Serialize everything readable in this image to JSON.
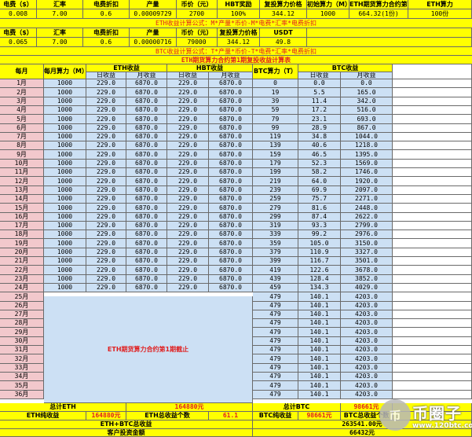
{
  "eth_params": {
    "headers": [
      "电费（$）",
      "汇率",
      "电费折扣",
      "产量",
      "币价（元）",
      "HBT奖励",
      "复投算力价格",
      "初始算力（M）",
      "ETH期货算力合约第1期",
      "ETH算力"
    ],
    "values": [
      "0.008",
      "7.00",
      "0.6",
      "0.00009729",
      "2700",
      "100%",
      "344.12",
      "1000",
      "664.32(1份)",
      "100份"
    ]
  },
  "eth_formula": "ETH收益计算公式：M*产量*币价-M*电费*汇率*电费折扣",
  "btc_params": {
    "headers": [
      "电费（$）",
      "汇率",
      "电费折扣",
      "产量",
      "币价（元）",
      "复投算力价格",
      "USDT"
    ],
    "values": [
      "0.065",
      "7.00",
      "0.6",
      "0.00000716",
      "79000",
      "344.12",
      "49.8"
    ]
  },
  "btc_formula": "BTC收益计算公式：T*产量*币价-T*电费*汇率*电费折扣",
  "table_title": "ETH期货算力合约第1期复投收益计算表",
  "table_headers": {
    "month": "每月",
    "monthly_hash": "每月算力（M）",
    "eth_income": "ETH收益",
    "hbt_income": "HBT收益",
    "btc_hash": "BTC算力（T）",
    "btc_income": "BTC收益",
    "daily": "日收益",
    "monthly": "月收益"
  },
  "rows": [
    {
      "m": "1月",
      "hash": "1000",
      "ed": "229.0",
      "em": "6870.0",
      "hd": "229.0",
      "hm": "6870.0",
      "t": "0",
      "bd": "0.0",
      "bm": "0.0"
    },
    {
      "m": "2月",
      "hash": "1000",
      "ed": "229.0",
      "em": "6870.0",
      "hd": "229.0",
      "hm": "6870.0",
      "t": "19",
      "bd": "5.5",
      "bm": "165.0"
    },
    {
      "m": "3月",
      "hash": "1000",
      "ed": "229.0",
      "em": "6870.0",
      "hd": "229.0",
      "hm": "6870.0",
      "t": "39",
      "bd": "11.4",
      "bm": "342.0"
    },
    {
      "m": "4月",
      "hash": "1000",
      "ed": "229.0",
      "em": "6870.0",
      "hd": "229.0",
      "hm": "6870.0",
      "t": "59",
      "bd": "17.2",
      "bm": "516.0"
    },
    {
      "m": "5月",
      "hash": "1000",
      "ed": "229.0",
      "em": "6870.0",
      "hd": "229.0",
      "hm": "6870.0",
      "t": "79",
      "bd": "23.1",
      "bm": "693.0"
    },
    {
      "m": "6月",
      "hash": "1000",
      "ed": "229.0",
      "em": "6870.0",
      "hd": "229.0",
      "hm": "6870.0",
      "t": "99",
      "bd": "28.9",
      "bm": "867.0"
    },
    {
      "m": "7月",
      "hash": "1000",
      "ed": "229.0",
      "em": "6870.0",
      "hd": "229.0",
      "hm": "6870.0",
      "t": "119",
      "bd": "34.8",
      "bm": "1044.0"
    },
    {
      "m": "8月",
      "hash": "1000",
      "ed": "229.0",
      "em": "6870.0",
      "hd": "229.0",
      "hm": "6870.0",
      "t": "139",
      "bd": "40.6",
      "bm": "1218.0"
    },
    {
      "m": "9月",
      "hash": "1000",
      "ed": "229.0",
      "em": "6870.0",
      "hd": "229.0",
      "hm": "6870.0",
      "t": "159",
      "bd": "46.5",
      "bm": "1395.0"
    },
    {
      "m": "10月",
      "hash": "1000",
      "ed": "229.0",
      "em": "6870.0",
      "hd": "229.0",
      "hm": "6870.0",
      "t": "179",
      "bd": "52.3",
      "bm": "1569.0"
    },
    {
      "m": "11月",
      "hash": "1000",
      "ed": "229.0",
      "em": "6870.0",
      "hd": "229.0",
      "hm": "6870.0",
      "t": "199",
      "bd": "58.2",
      "bm": "1746.0"
    },
    {
      "m": "12月",
      "hash": "1000",
      "ed": "229.0",
      "em": "6870.0",
      "hd": "229.0",
      "hm": "6870.0",
      "t": "219",
      "bd": "64.0",
      "bm": "1920.0"
    },
    {
      "m": "13月",
      "hash": "1000",
      "ed": "229.0",
      "em": "6870.0",
      "hd": "229.0",
      "hm": "6870.0",
      "t": "239",
      "bd": "69.9",
      "bm": "2097.0"
    },
    {
      "m": "14月",
      "hash": "1000",
      "ed": "229.0",
      "em": "6870.0",
      "hd": "229.0",
      "hm": "6870.0",
      "t": "259",
      "bd": "75.7",
      "bm": "2271.0"
    },
    {
      "m": "15月",
      "hash": "1000",
      "ed": "229.0",
      "em": "6870.0",
      "hd": "229.0",
      "hm": "6870.0",
      "t": "279",
      "bd": "81.6",
      "bm": "2448.0"
    },
    {
      "m": "16月",
      "hash": "1000",
      "ed": "229.0",
      "em": "6870.0",
      "hd": "229.0",
      "hm": "6870.0",
      "t": "299",
      "bd": "87.4",
      "bm": "2622.0"
    },
    {
      "m": "17月",
      "hash": "1000",
      "ed": "229.0",
      "em": "6870.0",
      "hd": "229.0",
      "hm": "6870.0",
      "t": "319",
      "bd": "93.3",
      "bm": "2799.0"
    },
    {
      "m": "18月",
      "hash": "1000",
      "ed": "229.0",
      "em": "6870.0",
      "hd": "229.0",
      "hm": "6870.0",
      "t": "339",
      "bd": "99.2",
      "bm": "2976.0"
    },
    {
      "m": "19月",
      "hash": "1000",
      "ed": "229.0",
      "em": "6870.0",
      "hd": "229.0",
      "hm": "6870.0",
      "t": "359",
      "bd": "105.0",
      "bm": "3150.0"
    },
    {
      "m": "20月",
      "hash": "1000",
      "ed": "229.0",
      "em": "6870.0",
      "hd": "229.0",
      "hm": "6870.0",
      "t": "379",
      "bd": "110.9",
      "bm": "3327.0"
    },
    {
      "m": "21月",
      "hash": "1000",
      "ed": "229.0",
      "em": "6870.0",
      "hd": "229.0",
      "hm": "6870.0",
      "t": "399",
      "bd": "116.7",
      "bm": "3501.0"
    },
    {
      "m": "22月",
      "hash": "1000",
      "ed": "229.0",
      "em": "6870.0",
      "hd": "229.0",
      "hm": "6870.0",
      "t": "419",
      "bd": "122.6",
      "bm": "3678.0"
    },
    {
      "m": "23月",
      "hash": "1000",
      "ed": "229.0",
      "em": "6870.0",
      "hd": "229.0",
      "hm": "6870.0",
      "t": "439",
      "bd": "128.4",
      "bm": "3852.0"
    },
    {
      "m": "24月",
      "hash": "1000",
      "ed": "229.0",
      "em": "6870.0",
      "hd": "229.0",
      "hm": "6870.0",
      "t": "459",
      "bd": "134.3",
      "bm": "4029.0"
    },
    {
      "m": "25月",
      "t": "479",
      "bd": "140.1",
      "bm": "4203.0"
    },
    {
      "m": "26月",
      "t": "479",
      "bd": "140.1",
      "bm": "4203.0"
    },
    {
      "m": "27月",
      "t": "479",
      "bd": "140.1",
      "bm": "4203.0"
    },
    {
      "m": "28月",
      "t": "479",
      "bd": "140.1",
      "bm": "4203.0"
    },
    {
      "m": "29月",
      "t": "479",
      "bd": "140.1",
      "bm": "4203.0"
    },
    {
      "m": "30月",
      "t": "479",
      "bd": "140.1",
      "bm": "4203.0"
    },
    {
      "m": "31月",
      "t": "479",
      "bd": "140.1",
      "bm": "4203.0"
    },
    {
      "m": "32月",
      "t": "479",
      "bd": "140.1",
      "bm": "4203.0"
    },
    {
      "m": "33月",
      "t": "479",
      "bd": "140.1",
      "bm": "4203.0"
    },
    {
      "m": "34月",
      "t": "479",
      "bd": "140.1",
      "bm": "4203.0"
    },
    {
      "m": "35月",
      "t": "479",
      "bd": "140.1",
      "bm": "4203.0"
    },
    {
      "m": "36月",
      "t": "479",
      "bd": "140.1",
      "bm": "4203.0"
    }
  ],
  "eth_end_note": "ETH期货算力合约第1期截止",
  "summary": {
    "total_eth_label": "总计ETH",
    "total_eth_value": "164880元",
    "total_btc_label": "总计BTC",
    "total_btc_value": "98661元",
    "eth_net_label": "ETH纯收益",
    "eth_net_value": "164880元",
    "eth_count_label": "ETH总收益个数",
    "eth_count_value": "61.1",
    "btc_net_label": "BTC纯收益",
    "btc_net_value": "98661元",
    "btc_count_label": "BTC总收益个数",
    "total_label": "ETH+BTC总收益",
    "total_value": "263541.00元",
    "customer_label": "客户投资金额",
    "customer_value": "66432元"
  },
  "watermark": {
    "logo": "币",
    "text": "币圈子",
    "url": "www.120btc.com"
  },
  "colors": {
    "yellow": "#ffff00",
    "blue": "#cce0f4",
    "pink": "#f2c8cc",
    "red": "#e02020"
  }
}
